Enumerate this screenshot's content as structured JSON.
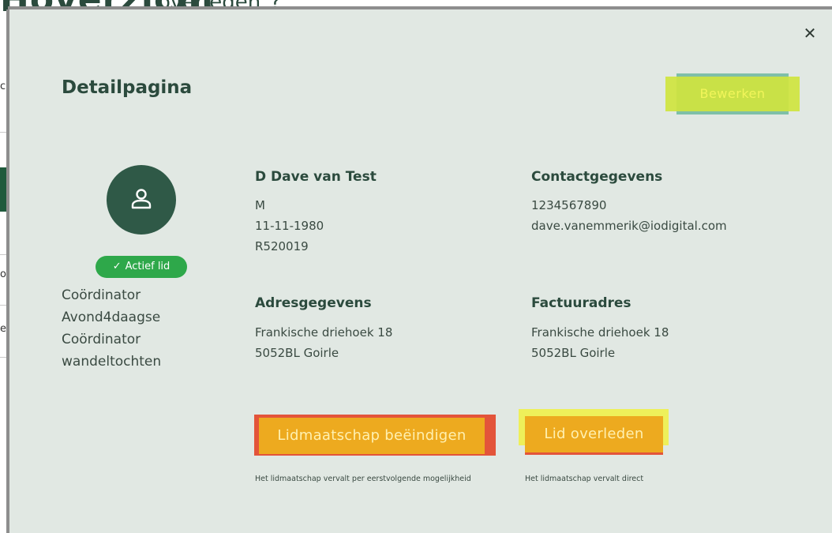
{
  "background": {
    "heading": "Hoverzicht",
    "subheading": "overleden\"?",
    "left_chars": [
      "c",
      "o",
      "e"
    ]
  },
  "modal": {
    "title": "Detailpagina",
    "close_icon": "close-icon",
    "edit_label": "Bewerken",
    "avatar_icon": "user-icon",
    "status_badge": "Actief lid",
    "roles": [
      "Coördinator",
      "Avond4daagse",
      "Coördinator",
      "wandeltochten"
    ],
    "person": {
      "heading": "D Dave van Test",
      "gender": "M",
      "birthdate": "11-11-1980",
      "member_id": "R520019"
    },
    "contact": {
      "heading": "Contactgegevens",
      "phone": "1234567890",
      "email": "dave.vanemmerik@iodigital.com"
    },
    "address": {
      "heading": "Adresgegevens",
      "street": "Frankische driehoek 18",
      "city": "5052BL Goirle"
    },
    "invoice": {
      "heading": "Factuuradres",
      "street": "Frankische driehoek 18",
      "city": "5052BL Goirle"
    },
    "actions": {
      "end_membership_label": "Lidmaatschap beëindigen",
      "end_membership_hint": "Het lidmaatschap vervalt per eerstvolgende mogelijkheid",
      "deceased_label": "Lid overleden",
      "deceased_hint": "Het lidmaatschap vervalt direct"
    }
  },
  "colors": {
    "modal_bg": "#e1e8e3",
    "heading": "#2b4a3d",
    "badge": "#2ea84a",
    "action_button": "#edaa1f",
    "highlight_red": "#e3543a",
    "highlight_yellow": "#eef05a",
    "edit_highlight": "#cfe43f"
  }
}
